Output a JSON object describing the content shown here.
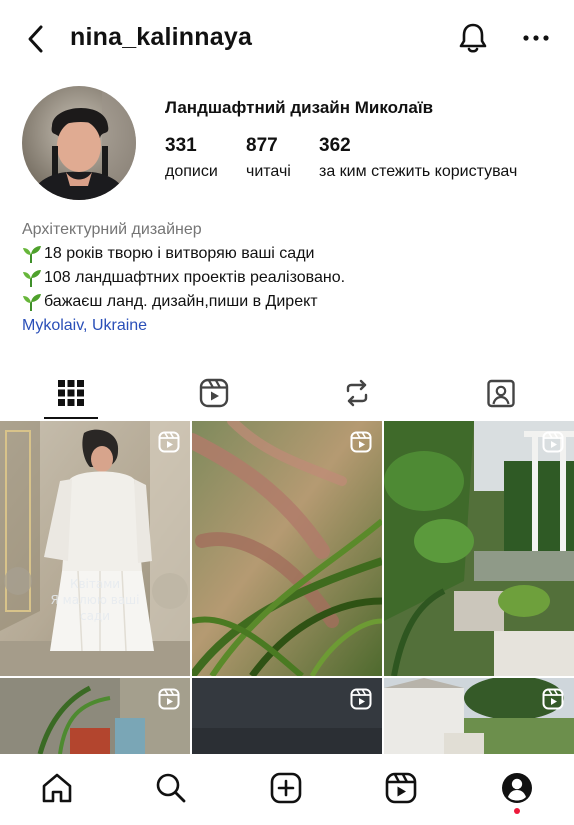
{
  "header": {
    "username": "nina_kalinnaya",
    "back_icon": "chevron-left-icon",
    "notifications_icon": "bell-icon",
    "more_icon": "more-horizontal-icon"
  },
  "profile": {
    "display_name": "Ландшафтний дизайн Миколаїв",
    "stats": [
      {
        "value": "331",
        "label": "дописи"
      },
      {
        "value": "877",
        "label": "читачі"
      },
      {
        "value": "362",
        "label": "за ким стежить користувач"
      }
    ]
  },
  "bio": {
    "category": "Архітектурний дизайнер",
    "lines": [
      "18 років творю і витворяю ваші сади",
      "108 ландшафтних проектів реалізовано.",
      "бажаєш ланд. дизайн,пиши в Директ"
    ],
    "line_emoji": "seedling-icon",
    "location": "Mykolaiv, Ukraine",
    "link_color": "#2a4fb8"
  },
  "tabs": [
    {
      "name": "posts-grid",
      "icon": "grid-icon",
      "active": true
    },
    {
      "name": "reels",
      "icon": "reels-icon",
      "active": false
    },
    {
      "name": "reposts",
      "icon": "repost-icon",
      "active": false
    },
    {
      "name": "tagged",
      "icon": "tagged-user-icon",
      "active": false
    }
  ],
  "grid": {
    "posts": [
      {
        "kind": "reel",
        "overlay_lines": [
          "Квітами",
          "Я малюю ваші",
          "сади"
        ]
      },
      {
        "kind": "reel"
      },
      {
        "kind": "reel"
      },
      {
        "kind": "reel"
      },
      {
        "kind": "reel"
      },
      {
        "kind": "reel"
      }
    ]
  },
  "bottom_nav": [
    {
      "name": "home",
      "icon": "home-icon"
    },
    {
      "name": "search",
      "icon": "search-icon"
    },
    {
      "name": "create",
      "icon": "add-post-icon"
    },
    {
      "name": "reels",
      "icon": "reels-icon"
    },
    {
      "name": "profile",
      "icon": "profile-icon",
      "has_notification": true
    }
  ],
  "colors": {
    "text": "#111111",
    "muted": "#757575",
    "notification_dot": "#ed1a3b"
  }
}
